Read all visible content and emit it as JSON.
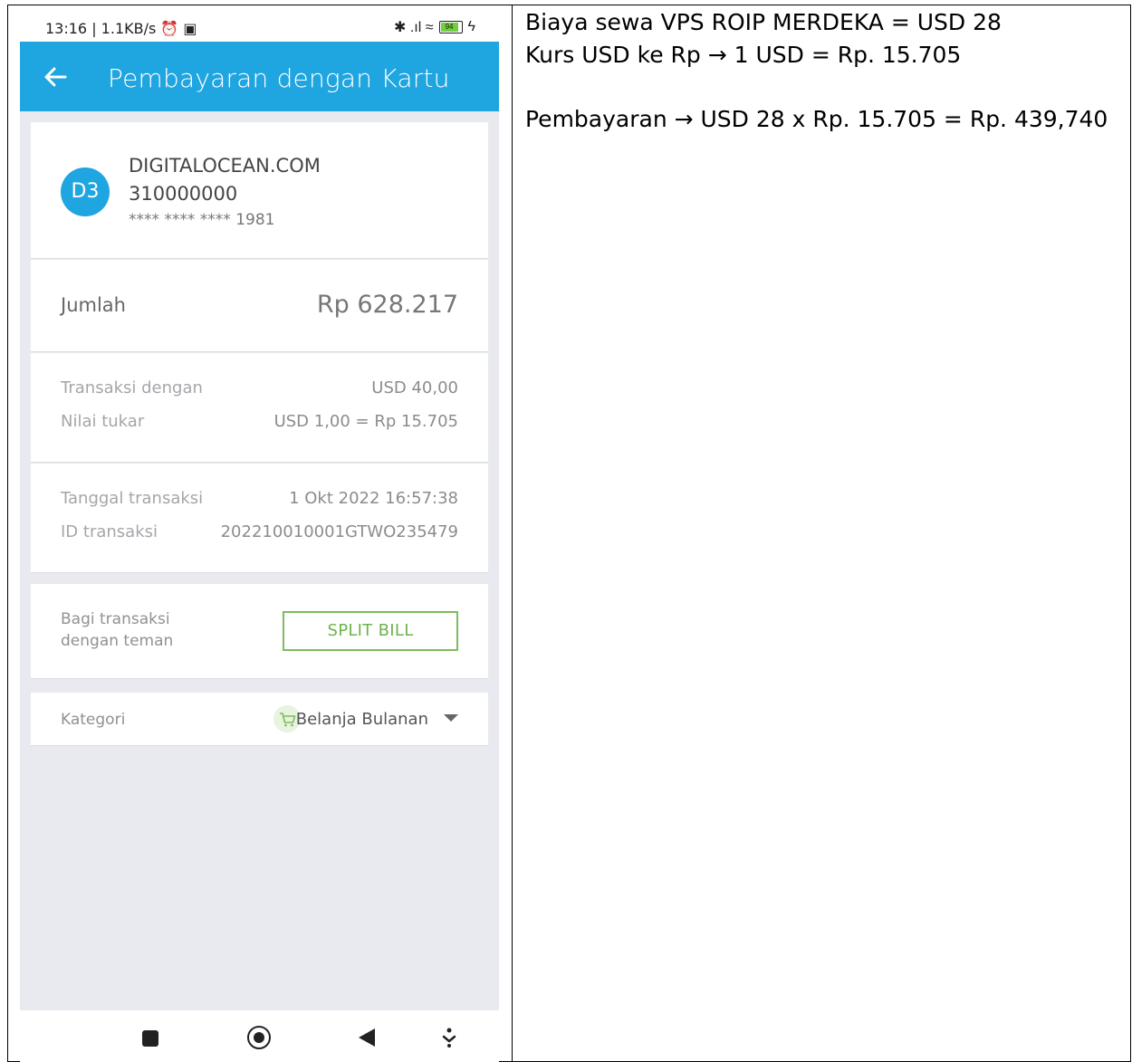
{
  "status_bar": {
    "time": "13:16 | 1.1KB/s ⏰ ▣",
    "icons": "✱ .ıl ≈",
    "battery": "94"
  },
  "app_bar": {
    "title": "Pembayaran dengan Kartu"
  },
  "merchant": {
    "avatar": "D3",
    "name": "DIGITALOCEAN.COM",
    "code": "310000000",
    "card_number": "**** **** **** 1981"
  },
  "amount": {
    "label": "Jumlah",
    "value": "Rp 628.217"
  },
  "conversion": {
    "currency_label": "Transaksi dengan",
    "currency_value": "USD 40,00",
    "rate_label": "Nilai tukar",
    "rate_value": "USD 1,00 = Rp 15.705"
  },
  "transaction": {
    "date_label": "Tanggal transaksi",
    "date_value": "1 Okt 2022 16:57:38",
    "id_label": "ID transaksi",
    "id_value": "202210010001GTWO235479"
  },
  "split": {
    "label_line1": "Bagi transaksi",
    "label_line2": "dengan teman",
    "button": "SPLIT BILL"
  },
  "category": {
    "label": "Kategori",
    "value": "Belanja Bulanan"
  },
  "note": {
    "line1": "Biaya sewa VPS ROIP MERDEKA = USD 28",
    "line2": "Kurs USD ke Rp → 1 USD = Rp. 15.705",
    "line3": "Pembayaran → USD 28 x Rp. 15.705 = Rp. 439,740"
  },
  "colors": {
    "accent": "#1fa5e0",
    "split_green": "#6db34d",
    "background": "#e9eaef"
  }
}
